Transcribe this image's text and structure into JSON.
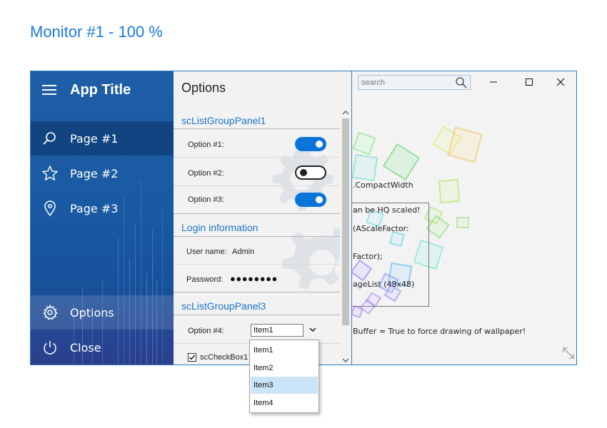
{
  "monitor_title": "Monitor #1 - 100 %",
  "app": {
    "title": "App Title",
    "nav_items": [
      {
        "label": "Page #1",
        "icon": "search-icon",
        "selected": true
      },
      {
        "label": "Page #2",
        "icon": "star-icon"
      },
      {
        "label": "Page #3",
        "icon": "map-pin-icon"
      }
    ],
    "bottom_items": [
      {
        "label": "Options",
        "icon": "gear-icon"
      },
      {
        "label": "Close",
        "icon": "power-icon"
      }
    ]
  },
  "options": {
    "title": "Options",
    "group1": {
      "header": "scListGroupPanel1",
      "rows": [
        {
          "label": "Option #1:",
          "on": true
        },
        {
          "label": "Option #2:",
          "on": false
        },
        {
          "label": "Option #3:",
          "on": true
        }
      ]
    },
    "group2": {
      "header": "Login information",
      "username_label": "User name:",
      "username_value": "Admin",
      "password_label": "Password:",
      "password_value": "●●●●●●●●"
    },
    "group3": {
      "header": "scListGroupPanel3",
      "option4_label": "Option #4:",
      "option4_value": "Item1",
      "checkbox_label": "scCheckBox1",
      "checkbox_checked": true
    }
  },
  "dropdown": {
    "items": [
      "Item1",
      "Item2",
      "Item3",
      "Item4"
    ],
    "highlighted": "Item3"
  },
  "wallpaper": {
    "search_placeholder": "search",
    "text_lines": [
      ".CompactWidth",
      "an be HQ scaled!",
      "(AScaleFactor:",
      "Factor);",
      "ageList (48x48)",
      "Buffer = True to force drawing of wallpaper!"
    ]
  },
  "colors": {
    "accent": "#0a74d8",
    "nav_bg": "#1f5ea6",
    "group_header": "#1f74c9",
    "monitor_title": "#1a7ae0"
  }
}
